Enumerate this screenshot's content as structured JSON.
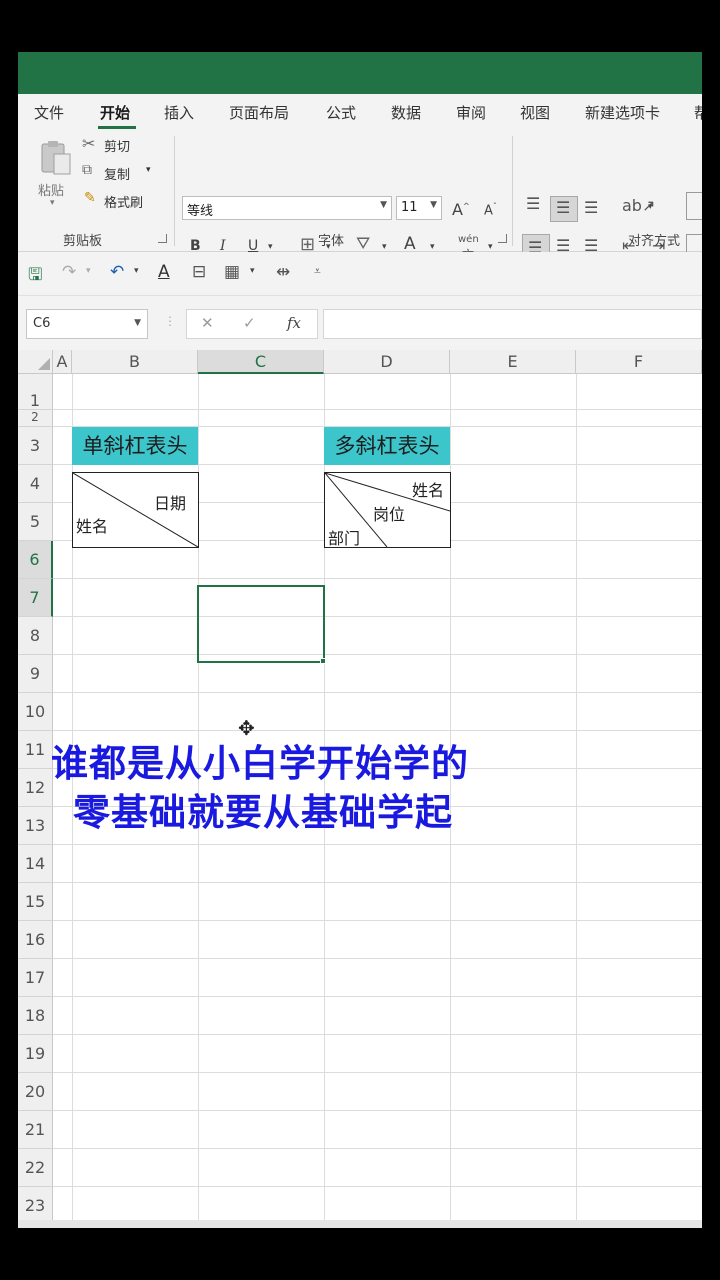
{
  "ribbon_tabs": [
    "文件",
    "开始",
    "插入",
    "页面布局",
    "公式",
    "数据",
    "审阅",
    "视图",
    "新建选项卡",
    "帮"
  ],
  "clipboard": {
    "paste": "粘贴",
    "cut": "剪切",
    "copy": "复制",
    "format_painter": "格式刷",
    "group_label": "剪贴板"
  },
  "font_group": {
    "font_name": "等线",
    "font_size": "11",
    "bold": "B",
    "italic": "I",
    "underline": "U",
    "font_color_glyph": "A",
    "phonetic": "wén",
    "group_label": "字体"
  },
  "alignment_group": {
    "group_label": "对齐方式"
  },
  "formula_bar": {
    "name_box": "C6",
    "cancel": "✕",
    "enter": "✓",
    "fx": "fx",
    "content": ""
  },
  "sheet": {
    "columns": [
      "A",
      "B",
      "C",
      "D",
      "E",
      "F"
    ],
    "rows": [
      "1",
      "2",
      "3",
      "4",
      "5",
      "6",
      "7",
      "8",
      "9",
      "10",
      "11",
      "12",
      "13",
      "14",
      "15",
      "16",
      "17",
      "18",
      "19",
      "20",
      "21",
      "22",
      "23"
    ],
    "active_cell": "C6",
    "header_fill_color": "#3cc6cb",
    "single_title": "单斜杠表头",
    "single_top_right": "日期",
    "single_bottom_left": "姓名",
    "multi_title": "多斜杠表头",
    "multi_top_right": "姓名",
    "multi_middle": "岗位",
    "multi_bottom_left": "部门"
  },
  "caption": {
    "line1": "谁都是从小白学开始学的",
    "line2": "零基础就要从基础学起",
    "color": "#1919e0"
  },
  "colors": {
    "excel_green": "#217346"
  }
}
